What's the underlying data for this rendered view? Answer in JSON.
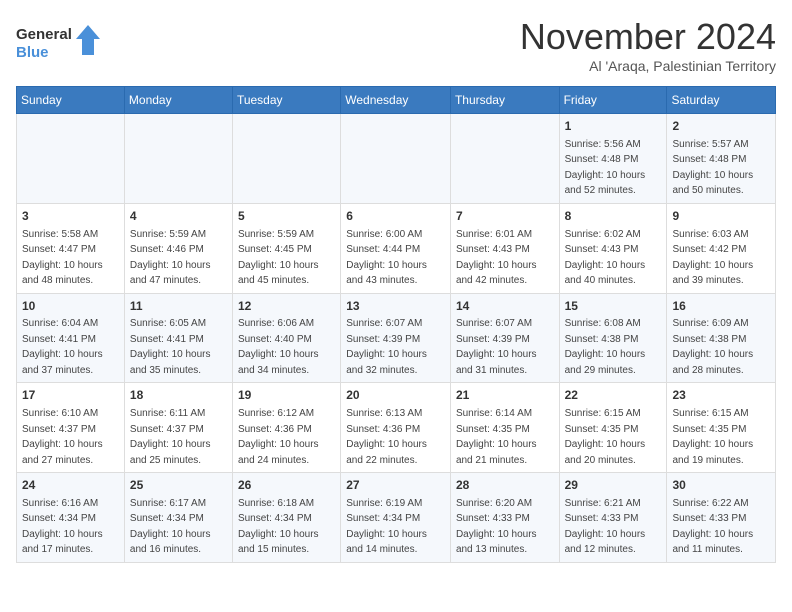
{
  "logo": {
    "line1": "General",
    "line2": "Blue"
  },
  "title": "November 2024",
  "subtitle": "Al 'Araqa, Palestinian Territory",
  "weekdays": [
    "Sunday",
    "Monday",
    "Tuesday",
    "Wednesday",
    "Thursday",
    "Friday",
    "Saturday"
  ],
  "rows": [
    [
      {
        "day": "",
        "info": ""
      },
      {
        "day": "",
        "info": ""
      },
      {
        "day": "",
        "info": ""
      },
      {
        "day": "",
        "info": ""
      },
      {
        "day": "",
        "info": ""
      },
      {
        "day": "1",
        "info": "Sunrise: 5:56 AM\nSunset: 4:48 PM\nDaylight: 10 hours and 52 minutes."
      },
      {
        "day": "2",
        "info": "Sunrise: 5:57 AM\nSunset: 4:48 PM\nDaylight: 10 hours and 50 minutes."
      }
    ],
    [
      {
        "day": "3",
        "info": "Sunrise: 5:58 AM\nSunset: 4:47 PM\nDaylight: 10 hours and 48 minutes."
      },
      {
        "day": "4",
        "info": "Sunrise: 5:59 AM\nSunset: 4:46 PM\nDaylight: 10 hours and 47 minutes."
      },
      {
        "day": "5",
        "info": "Sunrise: 5:59 AM\nSunset: 4:45 PM\nDaylight: 10 hours and 45 minutes."
      },
      {
        "day": "6",
        "info": "Sunrise: 6:00 AM\nSunset: 4:44 PM\nDaylight: 10 hours and 43 minutes."
      },
      {
        "day": "7",
        "info": "Sunrise: 6:01 AM\nSunset: 4:43 PM\nDaylight: 10 hours and 42 minutes."
      },
      {
        "day": "8",
        "info": "Sunrise: 6:02 AM\nSunset: 4:43 PM\nDaylight: 10 hours and 40 minutes."
      },
      {
        "day": "9",
        "info": "Sunrise: 6:03 AM\nSunset: 4:42 PM\nDaylight: 10 hours and 39 minutes."
      }
    ],
    [
      {
        "day": "10",
        "info": "Sunrise: 6:04 AM\nSunset: 4:41 PM\nDaylight: 10 hours and 37 minutes."
      },
      {
        "day": "11",
        "info": "Sunrise: 6:05 AM\nSunset: 4:41 PM\nDaylight: 10 hours and 35 minutes."
      },
      {
        "day": "12",
        "info": "Sunrise: 6:06 AM\nSunset: 4:40 PM\nDaylight: 10 hours and 34 minutes."
      },
      {
        "day": "13",
        "info": "Sunrise: 6:07 AM\nSunset: 4:39 PM\nDaylight: 10 hours and 32 minutes."
      },
      {
        "day": "14",
        "info": "Sunrise: 6:07 AM\nSunset: 4:39 PM\nDaylight: 10 hours and 31 minutes."
      },
      {
        "day": "15",
        "info": "Sunrise: 6:08 AM\nSunset: 4:38 PM\nDaylight: 10 hours and 29 minutes."
      },
      {
        "day": "16",
        "info": "Sunrise: 6:09 AM\nSunset: 4:38 PM\nDaylight: 10 hours and 28 minutes."
      }
    ],
    [
      {
        "day": "17",
        "info": "Sunrise: 6:10 AM\nSunset: 4:37 PM\nDaylight: 10 hours and 27 minutes."
      },
      {
        "day": "18",
        "info": "Sunrise: 6:11 AM\nSunset: 4:37 PM\nDaylight: 10 hours and 25 minutes."
      },
      {
        "day": "19",
        "info": "Sunrise: 6:12 AM\nSunset: 4:36 PM\nDaylight: 10 hours and 24 minutes."
      },
      {
        "day": "20",
        "info": "Sunrise: 6:13 AM\nSunset: 4:36 PM\nDaylight: 10 hours and 22 minutes."
      },
      {
        "day": "21",
        "info": "Sunrise: 6:14 AM\nSunset: 4:35 PM\nDaylight: 10 hours and 21 minutes."
      },
      {
        "day": "22",
        "info": "Sunrise: 6:15 AM\nSunset: 4:35 PM\nDaylight: 10 hours and 20 minutes."
      },
      {
        "day": "23",
        "info": "Sunrise: 6:15 AM\nSunset: 4:35 PM\nDaylight: 10 hours and 19 minutes."
      }
    ],
    [
      {
        "day": "24",
        "info": "Sunrise: 6:16 AM\nSunset: 4:34 PM\nDaylight: 10 hours and 17 minutes."
      },
      {
        "day": "25",
        "info": "Sunrise: 6:17 AM\nSunset: 4:34 PM\nDaylight: 10 hours and 16 minutes."
      },
      {
        "day": "26",
        "info": "Sunrise: 6:18 AM\nSunset: 4:34 PM\nDaylight: 10 hours and 15 minutes."
      },
      {
        "day": "27",
        "info": "Sunrise: 6:19 AM\nSunset: 4:34 PM\nDaylight: 10 hours and 14 minutes."
      },
      {
        "day": "28",
        "info": "Sunrise: 6:20 AM\nSunset: 4:33 PM\nDaylight: 10 hours and 13 minutes."
      },
      {
        "day": "29",
        "info": "Sunrise: 6:21 AM\nSunset: 4:33 PM\nDaylight: 10 hours and 12 minutes."
      },
      {
        "day": "30",
        "info": "Sunrise: 6:22 AM\nSunset: 4:33 PM\nDaylight: 10 hours and 11 minutes."
      }
    ]
  ]
}
